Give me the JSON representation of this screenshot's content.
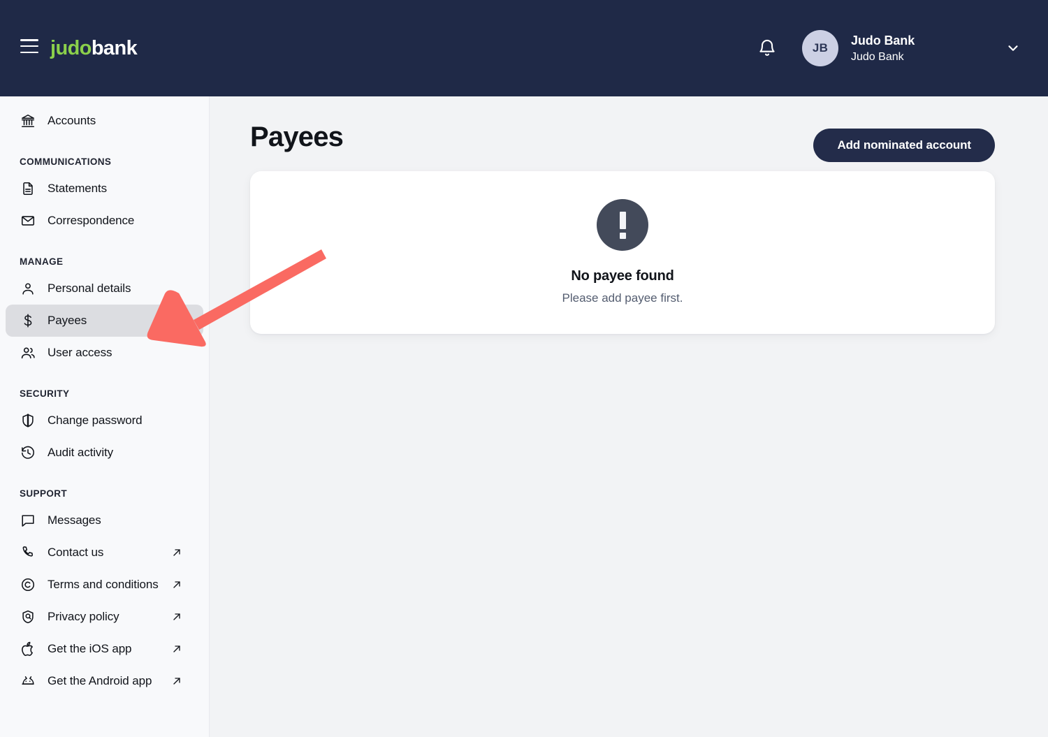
{
  "header": {
    "menu_icon": "hamburger-menu-icon",
    "logo_primary": "judo",
    "logo_secondary": "bank",
    "notifications_icon": "bell-icon",
    "avatar_initials": "JB",
    "account_name": "Judo Bank",
    "account_subtitle": "Judo Bank",
    "dropdown_icon": "chevron-down-icon",
    "background_color": "#1f2947",
    "logo_accent_color": "#8bd04b"
  },
  "sidebar": {
    "background_color": "#f8f9fb",
    "active_item_color": "#dcdde1",
    "groups": [
      {
        "title": null,
        "items": [
          {
            "label": "Accounts",
            "icon": "bank-icon",
            "external": false,
            "active": false
          }
        ]
      },
      {
        "title": "COMMUNICATIONS",
        "items": [
          {
            "label": "Statements",
            "icon": "document-icon",
            "external": false,
            "active": false
          },
          {
            "label": "Correspondence",
            "icon": "envelope-icon",
            "external": false,
            "active": false
          }
        ]
      },
      {
        "title": "MANAGE",
        "items": [
          {
            "label": "Personal details",
            "icon": "person-icon",
            "external": false,
            "active": false
          },
          {
            "label": "Payees",
            "icon": "dollar-sign-icon",
            "external": false,
            "active": true
          },
          {
            "label": "User access",
            "icon": "users-icon",
            "external": false,
            "active": false
          }
        ]
      },
      {
        "title": "SECURITY",
        "items": [
          {
            "label": "Change password",
            "icon": "shield-icon",
            "external": false,
            "active": false
          },
          {
            "label": "Audit activity",
            "icon": "history-clock-icon",
            "external": false,
            "active": false
          }
        ]
      },
      {
        "title": "SUPPORT",
        "items": [
          {
            "label": "Messages",
            "icon": "chat-bubble-icon",
            "external": false,
            "active": false
          },
          {
            "label": "Contact us",
            "icon": "phone-icon",
            "external": true,
            "active": false
          },
          {
            "label": "Terms and conditions",
            "icon": "copyright-icon",
            "external": true,
            "active": false
          },
          {
            "label": "Privacy policy",
            "icon": "privacy-shield-icon",
            "external": true,
            "active": false
          },
          {
            "label": "Get the iOS app",
            "icon": "apple-icon",
            "external": true,
            "active": false
          },
          {
            "label": "Get the Android app",
            "icon": "android-icon",
            "external": true,
            "active": false
          }
        ]
      }
    ]
  },
  "main": {
    "page_title": "Payees",
    "add_button_label": "Add nominated account",
    "add_button_color": "#232c4a",
    "empty_state": {
      "icon": "exclamation-circle-icon",
      "icon_color": "#434a5a",
      "title": "No payee found",
      "subtitle": "Please add payee first."
    }
  },
  "annotation": {
    "name": "red-arrow-pointing-to-payees",
    "color": "#fa6a62"
  }
}
